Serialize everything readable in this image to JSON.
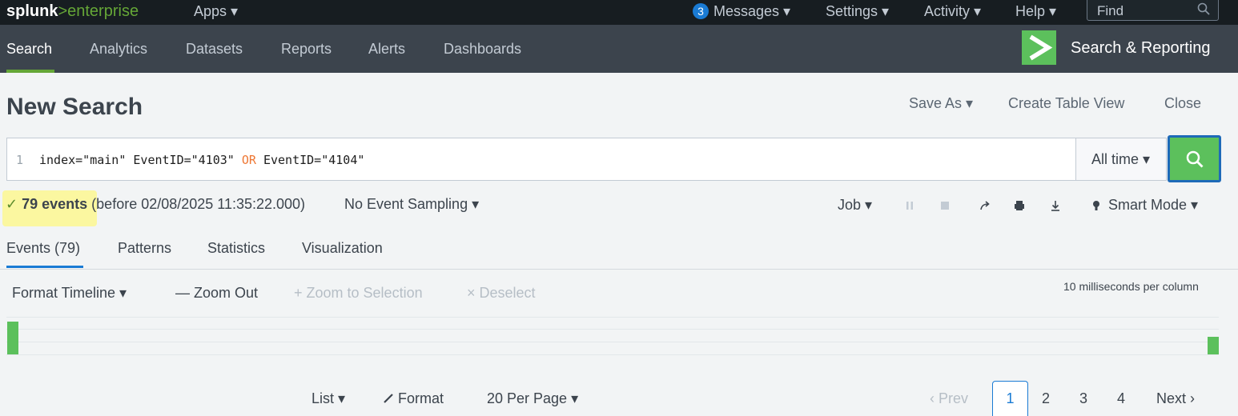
{
  "topbar": {
    "brand_main": "splunk",
    "brand_suffix": ">enterprise",
    "apps_label": "Apps ▾",
    "messages_count": "3",
    "messages_label": "Messages ▾",
    "settings_label": "Settings ▾",
    "activity_label": "Activity ▾",
    "help_label": "Help ▾",
    "find_placeholder": "Find"
  },
  "appbar": {
    "nav": [
      "Search",
      "Analytics",
      "Datasets",
      "Reports",
      "Alerts",
      "Dashboards"
    ],
    "active_index": 0,
    "app_title": "Search & Reporting"
  },
  "page": {
    "title": "New Search",
    "save_as": "Save As ▾",
    "create_table_view": "Create Table View",
    "close": "Close"
  },
  "search": {
    "line_number": "1",
    "query_part1": "index=\"main\" EventID=\"4103\" ",
    "query_keyword": "OR",
    "query_part2": " EventID=\"4104\"",
    "time_range": "All time ▾"
  },
  "status": {
    "check": "✓",
    "events_count": "79 events",
    "before_text": " (before 02/08/2025 11:35:22.000)",
    "sampling": "No Event Sampling ▾",
    "job_label": "Job ▾",
    "mode_label": "Smart Mode ▾"
  },
  "tabs": [
    "Events (79)",
    "Patterns",
    "Statistics",
    "Visualization"
  ],
  "timeline": {
    "format_label": "Format Timeline ▾",
    "zoom_out": "— Zoom Out",
    "zoom_selection": "+ Zoom to Selection",
    "deselect": "× Deselect",
    "scale": "10 milliseconds per column"
  },
  "pagination": {
    "list": "List ▾",
    "format": "Format",
    "per_page": "20 Per Page ▾",
    "prev": "‹ Prev",
    "pages": [
      "1",
      "2",
      "3",
      "4"
    ],
    "current_page": "1",
    "next": "Next ›"
  },
  "colors": {
    "splunk_green": "#65a637",
    "accent_blue": "#1a7bd4",
    "highlight_yellow": "#fbf7a0"
  }
}
